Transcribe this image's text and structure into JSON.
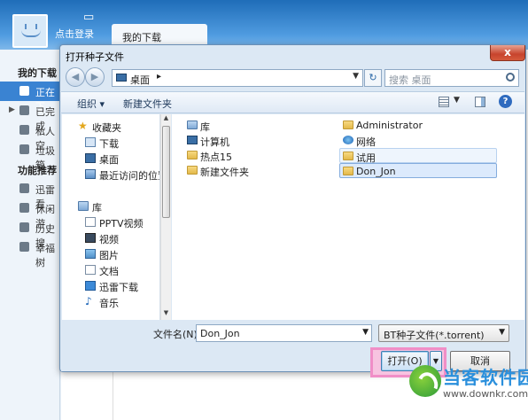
{
  "app": {
    "login_text": "点击登录",
    "tab_label": "我的下载",
    "window_controls": [
      "minimize-icon",
      "skin-icon",
      "settings-icon"
    ],
    "sidebar": {
      "section1_title": "我的下载",
      "items": [
        {
          "label": "正在下",
          "icon": "download-icon",
          "selected": true
        },
        {
          "label": "已完成",
          "icon": "check-icon",
          "selected": false
        },
        {
          "label": "私人空",
          "icon": "lock-icon",
          "selected": false
        },
        {
          "label": "垃圾箱",
          "icon": "trash-icon",
          "selected": false
        }
      ],
      "section2_title": "功能推荐",
      "items2": [
        {
          "label": "迅雷看",
          "icon": "thunder-icon"
        },
        {
          "label": "休闲游",
          "icon": "gamepad-icon"
        },
        {
          "label": "历史搜",
          "icon": "history-icon"
        },
        {
          "label": "幸福树",
          "icon": "leaf-icon"
        }
      ]
    }
  },
  "dialog": {
    "title": "打开种子文件",
    "close_label": "x",
    "address": "桌面",
    "search_placeholder": "搜索 桌面",
    "toolbar": {
      "organize": "组织 ▾",
      "new_folder": "新建文件夹"
    },
    "tree": [
      {
        "label": "收藏夹",
        "icon": "star-icon"
      },
      {
        "label": "下载",
        "icon": "download-folder-icon"
      },
      {
        "label": "桌面",
        "icon": "desktop-icon"
      },
      {
        "label": "最近访问的位置",
        "icon": "recent-places-icon"
      },
      {
        "label": "库",
        "icon": "library-icon"
      },
      {
        "label": "PPTV视频",
        "icon": "video-library-icon"
      },
      {
        "label": "视频",
        "icon": "video-icon"
      },
      {
        "label": "图片",
        "icon": "pictures-icon"
      },
      {
        "label": "文档",
        "icon": "documents-icon"
      },
      {
        "label": "迅雷下载",
        "icon": "thunder-download-icon"
      },
      {
        "label": "音乐",
        "icon": "music-icon"
      }
    ],
    "files": [
      {
        "label": "库",
        "icon": "library-icon"
      },
      {
        "label": "计算机",
        "icon": "computer-icon"
      },
      {
        "label": "热点15",
        "icon": "folder-icon"
      },
      {
        "label": "新建文件夹",
        "icon": "folder-icon"
      },
      {
        "label": "Administrator",
        "icon": "folder-icon"
      },
      {
        "label": "网络",
        "icon": "network-icon"
      },
      {
        "label": "试用",
        "icon": "folder-icon"
      },
      {
        "label": "Don_Jon",
        "icon": "folder-icon"
      }
    ],
    "filename_label": "文件名(N):",
    "filename_value": "Don_Jon",
    "filetype": "BT种子文件(*.torrent)",
    "open_label": "打开(O)",
    "cancel_label": "取消"
  },
  "watermark": {
    "title": "当客软件园",
    "url": "www.downkr.com"
  }
}
